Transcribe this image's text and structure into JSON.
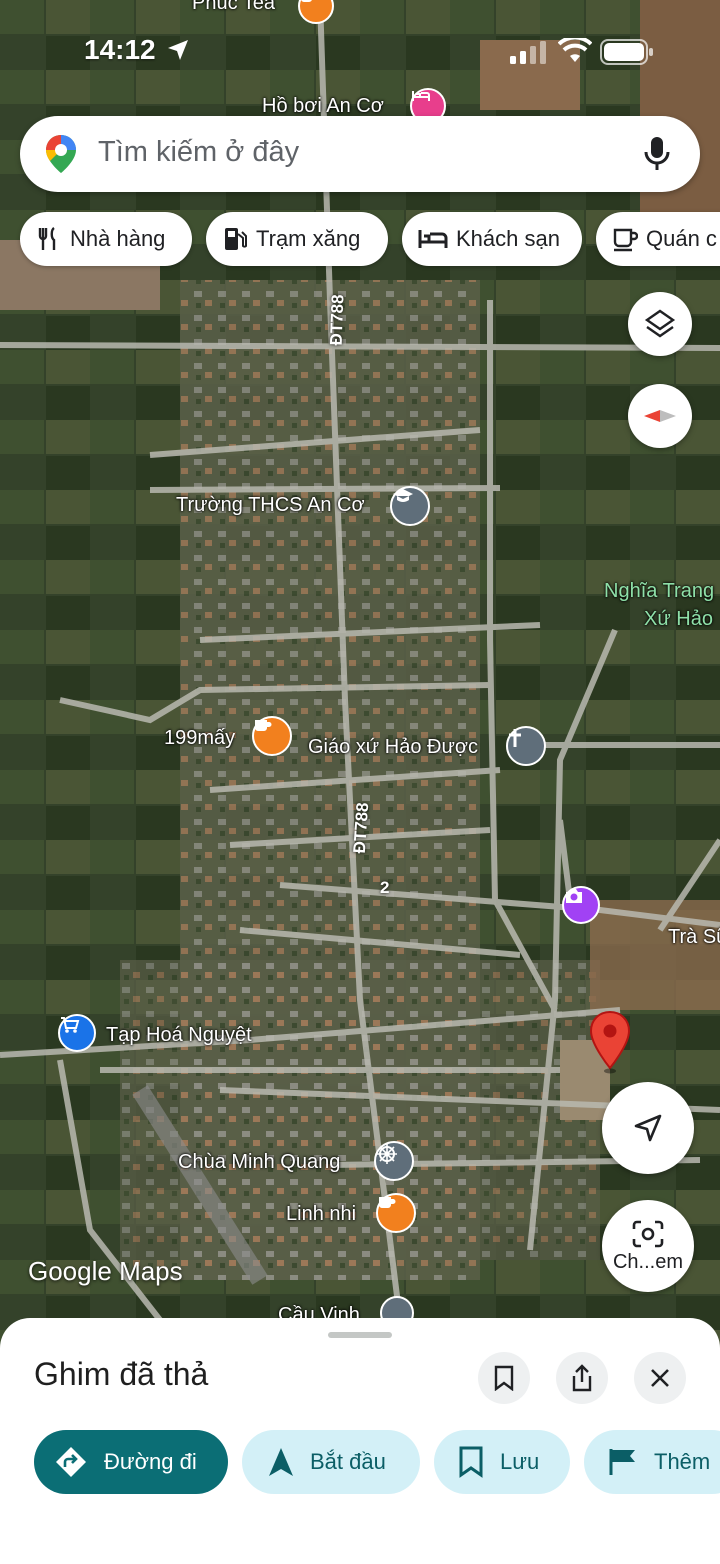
{
  "status_bar": {
    "time": "14:12"
  },
  "search": {
    "placeholder": "Tìm kiếm ở đây"
  },
  "chips": [
    {
      "label": "Nhà hàng",
      "icon": "fork-knife-icon"
    },
    {
      "label": "Trạm xăng",
      "icon": "gas-station-icon"
    },
    {
      "label": "Khách sạn",
      "icon": "bed-icon"
    },
    {
      "label": "Quán c",
      "icon": "coffee-cup-icon"
    }
  ],
  "map": {
    "labels": {
      "phuc_tea": "Phuc Tea",
      "ho_boi": "Hồ bơi An Cơ",
      "school": "Trường THCS An Cơ",
      "cemetery_line1": "Nghĩa Trang",
      "cemetery_line2": "Xứ Hảo",
      "shop_199": "199mấy",
      "church": "Giáo xứ Hảo Được",
      "tra_su": "Trà Sữ",
      "grocery": "Tạp Hoá Nguyệt",
      "pagoda": "Chùa Minh Quang",
      "linh_nhi": "Linh nhi",
      "bridge": "Cầu Vinh"
    },
    "road_labels": {
      "dt788_a": "ĐT788",
      "dt788_b": "ĐT788",
      "road_2": "2"
    },
    "camera_label": "Ch...em",
    "logo": "Google Maps"
  },
  "sheet": {
    "title": "Ghim đã thả",
    "actions": {
      "directions": "Đường đi",
      "start": "Bắt đầu",
      "save": "Lưu",
      "more": "Thêm"
    }
  },
  "colors": {
    "primary_teal": "#0b6e75",
    "secondary_pill": "#d3f0f7",
    "pin_red": "#ea4335",
    "poi_orange": "#f2801e",
    "poi_blue": "#1a73e8",
    "poi_purple": "#a142f4",
    "poi_gray": "#5f6e7a"
  }
}
